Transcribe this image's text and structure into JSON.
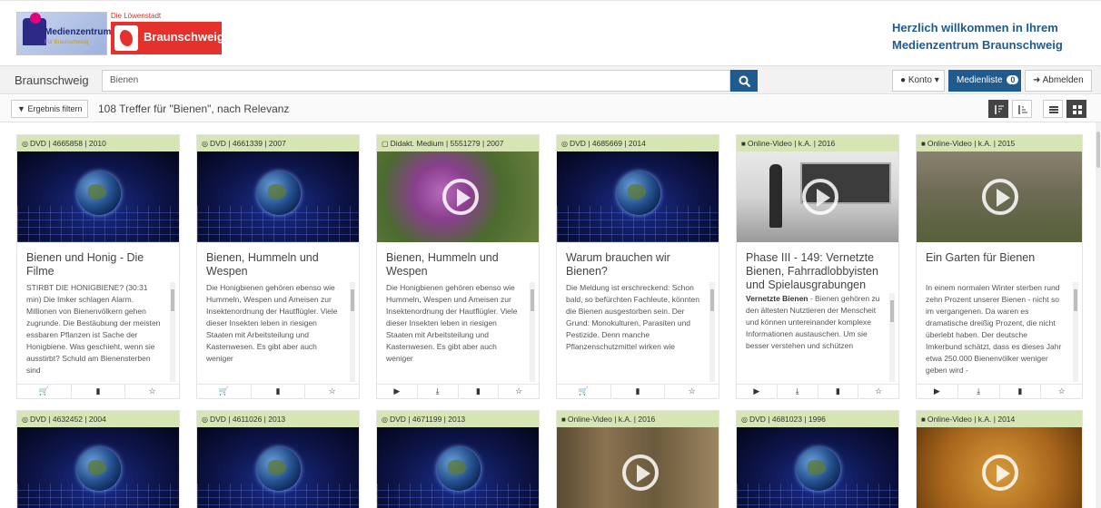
{
  "header": {
    "logo_mz_text": "Medienzentrum",
    "logo_mz_sub": "Für Braunschweig",
    "logo_bs_top": "Die Löwenstadt",
    "logo_bs_name": "Braunschweig",
    "welcome_line1": "Herzlich willkommen in Ihrem",
    "welcome_line2": "Medienzentrum Braunschweig"
  },
  "search": {
    "place": "Braunschweig",
    "value": "Bienen",
    "konto_label": "Konto",
    "medienliste_label": "Medienliste",
    "medienliste_count": "0",
    "abmelden_label": "Abmelden"
  },
  "filter": {
    "filter_label": "Ergebnis filtern",
    "hits_text": "108 Treffer für \"Bienen\", nach Relevanz"
  },
  "colors": {
    "accent": "#1f5b8f",
    "card_header": "#d7e4b4",
    "brand_red": "#e4312b"
  },
  "cards": [
    {
      "meta": "DVD | 4665858 | 2010",
      "icon": "disc-icon",
      "title": "Bienen und Honig - Die Filme",
      "desc": "STIRBT DIE HONIGBIENE? (30:31 min) Die Imker schlagen Alarm. Millionen von Bienenvölkern gehen zugrunde. Die Bestäubung der meisten essbaren Pflanzen ist Sache der Honigbiene. Was geschieht, wenn sie ausstirbt? Schuld am Bienensterben sind"
    },
    {
      "meta": "DVD | 4661339 | 2007",
      "icon": "disc-icon",
      "title": "Bienen, Hummeln und Wespen",
      "desc": "Die Honigbienen gehören ebenso wie Hummeln, Wespen und Ameisen zur Insektenordnung der Hautflügler. Viele dieser Insekten leben in riesigen Staaten mit Arbeitsteilung und Kastenwesen. Es gibt aber auch weniger"
    },
    {
      "meta": "Didakt. Medium | 5551279 | 2007",
      "icon": "monitor-icon",
      "title": "Bienen, Hummeln und Wespen",
      "desc": "Die Honigbienen gehören ebenso wie Hummeln, Wespen und Ameisen zur Insektenordnung der Hautflügler. Viele dieser Insekten leben in riesigen Staaten mit Arbeitsteilung und Kastenwesen. Es gibt aber auch weniger"
    },
    {
      "meta": "DVD | 4685669 | 2014",
      "icon": "disc-icon",
      "title": "Warum brauchen wir Bienen?",
      "desc": "Die Meldung ist erschreckend: Schon bald, so befürchten Fachleute, könnten die Bienen ausgestorben sein. Der Grund: Monokulturen, Parasiten und Pestizide. Denn manche Pflanzenschutzmittel wirken wie"
    },
    {
      "meta": "Online-Video | k.A. | 2016",
      "icon": "camera-icon",
      "title": "Phase III - 149: Vernetzte Bienen, Fahrradlobbyisten und Spielausgrabungen",
      "desc_bold": "Vernetzte Bienen",
      "desc": " - Bienen gehören zu den ältesten Nutztieren der Menscheit und können untereinander komplexe Informationen austauschen. Um sie besser verstehen und schützen"
    },
    {
      "meta": "Online-Video | k.A. | 2015",
      "icon": "camera-icon",
      "title": "Ein Garten für Bienen",
      "desc": "In einem normalen Winter sterben rund zehn Prozent unserer Bienen - nicht so im vergangenen. Da waren es dramatische dreißig Prozent, die nicht überlebt haben. Der deutsche Imkerbund schätzt, dass es dieses Jahr etwa 250.000 Bienenvölker weniger geben wird -"
    },
    {
      "meta": "DVD | 4632452 | 2004",
      "icon": "disc-icon"
    },
    {
      "meta": "DVD | 4611026 | 2013",
      "icon": "disc-icon"
    },
    {
      "meta": "DVD | 4671199 | 2013",
      "icon": "disc-icon"
    },
    {
      "meta": "Online-Video | k.A. | 2016",
      "icon": "camera-icon"
    },
    {
      "meta": "DVD | 4681023 | 1996",
      "icon": "disc-icon"
    },
    {
      "meta": "Online-Video | k.A. | 2014",
      "icon": "camera-icon"
    }
  ]
}
